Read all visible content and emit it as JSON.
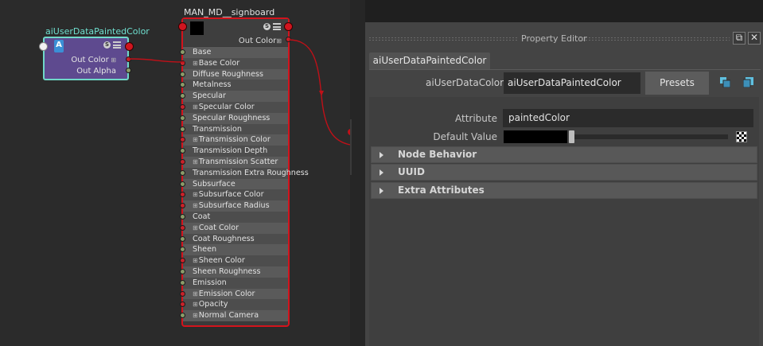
{
  "node_editor": {
    "small_node": {
      "title": "aiUserDataPaintedColor",
      "icon_letter": "A",
      "outputs": [
        "Out Color",
        "Out Alpha"
      ]
    },
    "big_node": {
      "title": "MAN_MD__signboard",
      "output": "Out Color",
      "attributes": [
        {
          "label": "Base",
          "port": "green",
          "plus": false
        },
        {
          "label": "Base Color",
          "port": "red",
          "plus": true
        },
        {
          "label": "Diffuse Roughness",
          "port": "green",
          "plus": false
        },
        {
          "label": "Metalness",
          "port": "green",
          "plus": false
        },
        {
          "label": "Specular",
          "port": "green",
          "plus": false
        },
        {
          "label": "Specular Color",
          "port": "red",
          "plus": true
        },
        {
          "label": "Specular Roughness",
          "port": "green",
          "plus": false
        },
        {
          "label": "Transmission",
          "port": "green",
          "plus": false
        },
        {
          "label": "Transmission Color",
          "port": "red",
          "plus": true
        },
        {
          "label": "Transmission Depth",
          "port": "green",
          "plus": false
        },
        {
          "label": "Transmission Scatter",
          "port": "red",
          "plus": true
        },
        {
          "label": "Transmission Extra Roughness",
          "port": "green",
          "plus": false
        },
        {
          "label": "Subsurface",
          "port": "green",
          "plus": false
        },
        {
          "label": "Subsurface Color",
          "port": "red",
          "plus": true
        },
        {
          "label": "Subsurface Radius",
          "port": "red",
          "plus": true
        },
        {
          "label": "Coat",
          "port": "green",
          "plus": false
        },
        {
          "label": "Coat Color",
          "port": "red",
          "plus": true
        },
        {
          "label": "Coat Roughness",
          "port": "green",
          "plus": false
        },
        {
          "label": "Sheen",
          "port": "green",
          "plus": false
        },
        {
          "label": "Sheen Color",
          "port": "red",
          "plus": true
        },
        {
          "label": "Sheen Roughness",
          "port": "green",
          "plus": false
        },
        {
          "label": "Emission",
          "port": "green",
          "plus": false
        },
        {
          "label": "Emission Color",
          "port": "red",
          "plus": true
        },
        {
          "label": "Opacity",
          "port": "red",
          "plus": true
        },
        {
          "label": "Normal Camera",
          "port": "green",
          "plus": true
        }
      ]
    }
  },
  "property_editor": {
    "title": "Property Editor",
    "tab_label": "aiUserDataPaintedColor",
    "node_label": "aiUserDataColor:",
    "node_value": "aiUserDataPaintedColor",
    "presets_label": "Presets",
    "attribute_label": "Attribute",
    "attribute_value": "paintedColor",
    "default_value_label": "Default Value",
    "default_value_color": "#000000",
    "default_value_slider": 0.0,
    "sections": [
      "Node Behavior",
      "UUID",
      "Extra Attributes"
    ]
  },
  "colors": {
    "node_red": "#d3131c",
    "small_node_border": "#6fd8c8",
    "small_node_fill": "#5e4a8f",
    "wire": "#c01018"
  }
}
